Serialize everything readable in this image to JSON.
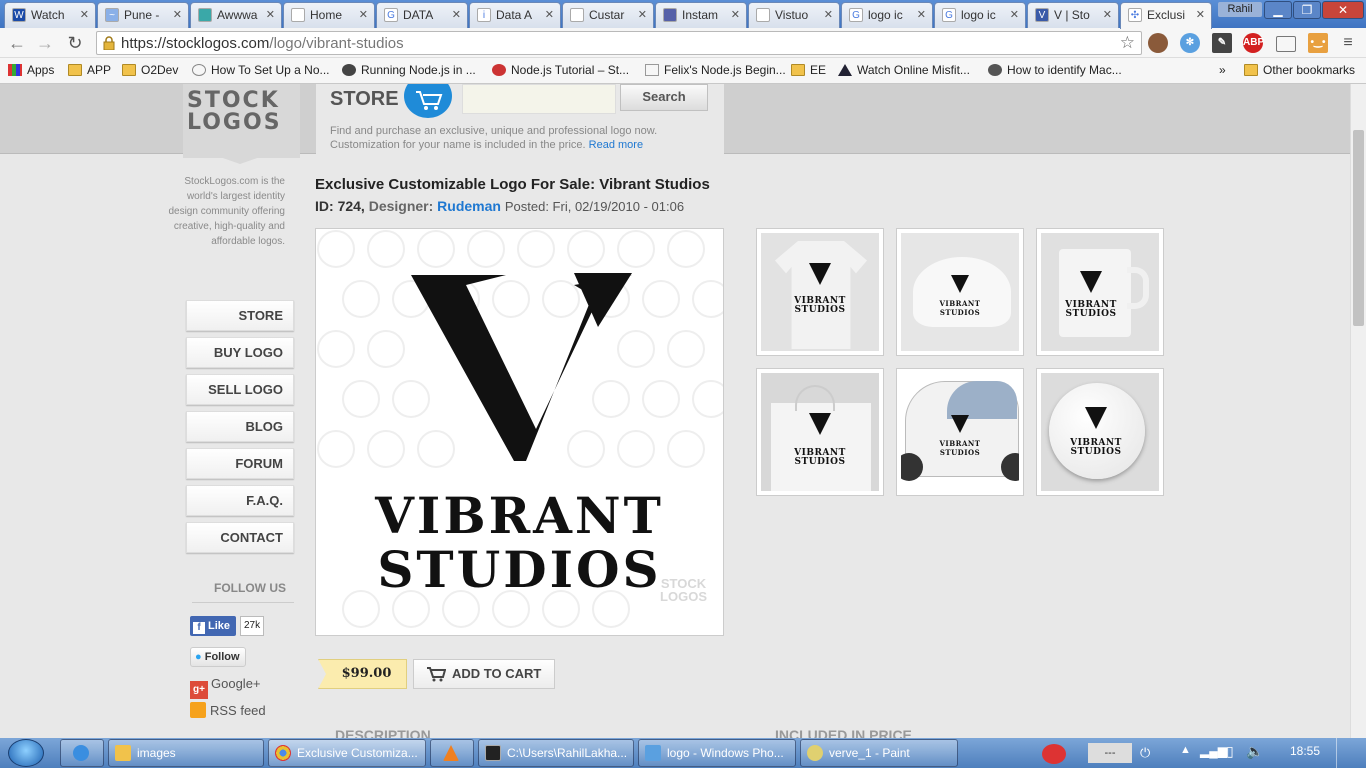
{
  "browser": {
    "tabs": [
      {
        "label": "Watch",
        "color": "#1a4aa8",
        "glyph": "W"
      },
      {
        "label": "Pune -",
        "color": "#8ab0e8",
        "glyph": "~"
      },
      {
        "label": "Awwwa",
        "color": "#3aa8a8",
        "glyph": ""
      },
      {
        "label": "Home",
        "color": "#ffffff",
        "glyph": ""
      },
      {
        "label": "DATA",
        "color": "#ffffff",
        "glyph": "G"
      },
      {
        "label": "Data A",
        "color": "#ffffff",
        "glyph": "i"
      },
      {
        "label": "Custar",
        "color": "#ffffff",
        "glyph": ""
      },
      {
        "label": "Instam",
        "color": "#5560a8",
        "glyph": ""
      },
      {
        "label": "Vistuo",
        "color": "#ffffff",
        "glyph": ""
      },
      {
        "label": "logo ic",
        "color": "#ffffff",
        "glyph": "G"
      },
      {
        "label": "logo ic",
        "color": "#ffffff",
        "glyph": "G"
      },
      {
        "label": "V | Sto",
        "color": "#3a5aa8",
        "glyph": "V"
      },
      {
        "label": "Exclusi",
        "color": "#ffffff",
        "glyph": "✣"
      }
    ],
    "user_name": "Rahil",
    "url_host": "https://stocklogos.com",
    "url_path": "/logo/vibrant-studios",
    "bookmarks": [
      "Apps",
      "APP",
      "O2Dev",
      "How To Set Up a No...",
      "Running Node.js in ...",
      "Node.js Tutorial – St...",
      "Felix's Node.js Begin...",
      "EE",
      "Watch Online Misfit...",
      "How to identify Mac..."
    ],
    "bookmarks_overflow": "»",
    "other_bookmarks": "Other bookmarks"
  },
  "site": {
    "logo_line1": "STOCK",
    "logo_line2": "LOGOS",
    "store_label": "STORE",
    "search_button": "Search",
    "store_desc": "Find and purchase an exclusive, unique and professional logo now. Customization for your name is included in the price.",
    "read_more": "Read more",
    "tagline": "StockLogos.com is the world's largest identity design community offering creative, high-quality and affordable logos.",
    "nav": [
      "STORE",
      "BUY LOGO",
      "SELL LOGO",
      "BLOG",
      "FORUM",
      "F.A.Q.",
      "CONTACT"
    ],
    "follow_us": "FOLLOW US",
    "fb_like": "Like",
    "fb_count": "27k",
    "twitter_follow": "Follow",
    "gplus": "Google+",
    "rss": "RSS feed"
  },
  "product": {
    "title": "Exclusive Customizable Logo For Sale: Vibrant Studios",
    "id_label": "ID:",
    "id_value": "724,",
    "designer_label": "Designer:",
    "designer": "Rudeman",
    "posted": "Posted: Fri, 02/19/2010 - 01:06",
    "logo_line1": "VIBRANT",
    "logo_line2": "STUDIOS",
    "watermark1": "STOCK",
    "watermark2": "LOGOS",
    "price": "$99.00",
    "add_to_cart": "ADD TO CART",
    "section_description": "DESCRIPTION",
    "section_included": "INCLUDED IN PRICE",
    "thumbs": [
      "VIBRANT STUDIOS",
      "VIBRANT STUDIOS",
      "VIBRANT STUDIOS",
      "VIBRANT STUDIOS",
      "VIBRANT STUDIOS",
      "VIBRANT STUDIOS"
    ]
  },
  "taskbar": {
    "items": [
      "images",
      "Exclusive Customiza...",
      "",
      "C:\\Users\\RahilLakha...",
      "logo - Windows Pho...",
      "verve_1 - Paint"
    ],
    "clock": "18:55",
    "tray_text": "---"
  }
}
